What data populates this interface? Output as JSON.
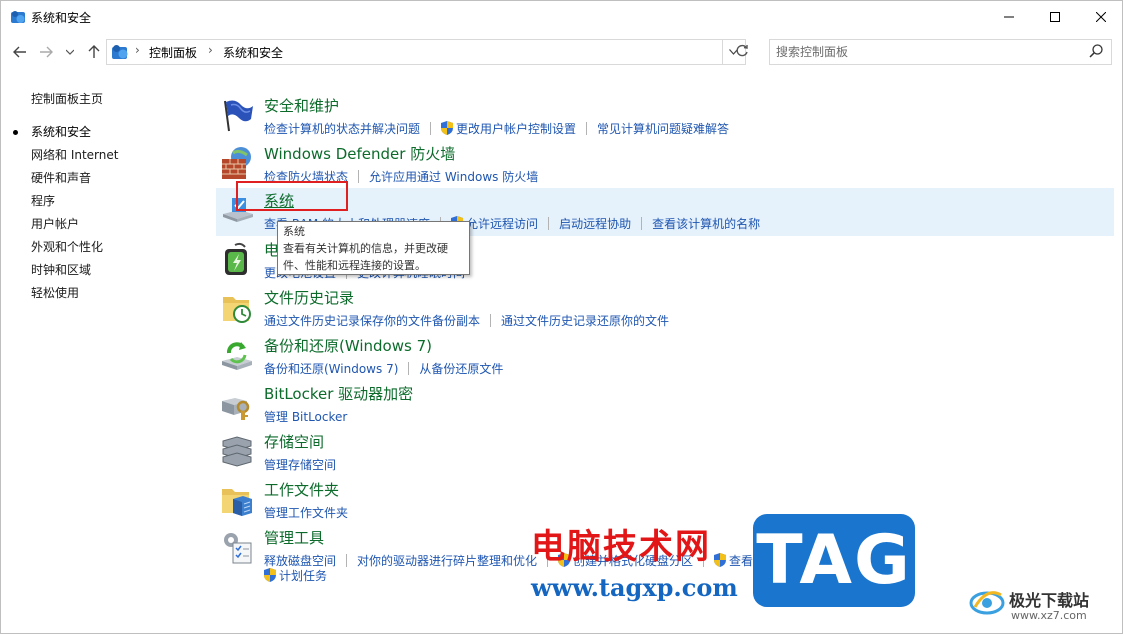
{
  "window": {
    "title": "系统和安全",
    "controls": {
      "minimize": "—",
      "maximize": "☐",
      "close": "✕"
    }
  },
  "navbar": {
    "breadcrumbs": [
      "控制面板",
      "系统和安全"
    ],
    "search_placeholder": "搜索控制面板"
  },
  "sidebar": {
    "items": [
      {
        "label": "控制面板主页"
      },
      {
        "label": "系统和安全",
        "current": true
      },
      {
        "label": "网络和 Internet"
      },
      {
        "label": "硬件和声音"
      },
      {
        "label": "程序"
      },
      {
        "label": "用户帐户"
      },
      {
        "label": "外观和个性化"
      },
      {
        "label": "时钟和区域"
      },
      {
        "label": "轻松使用"
      }
    ]
  },
  "categories": [
    {
      "title": "安全和维护",
      "icon": "flag-icon",
      "links": [
        "检查计算机的状态并解决问题",
        "更改用户帐户控制设置",
        "常见计算机问题疑难解答"
      ]
    },
    {
      "title": "Windows Defender 防火墙",
      "icon": "firewall-icon",
      "links": [
        "检查防火墙状态",
        "允许应用通过 Windows 防火墙"
      ]
    },
    {
      "title": "系统",
      "icon": "system-icon",
      "links": [
        "查看 RAM 的大小和处理器速度",
        "允许远程访问",
        "启动远程协助",
        "查看该计算机的名称"
      ]
    },
    {
      "title": "电源选项",
      "icon": "power-icon",
      "links": [
        "更改电池设置",
        "更改计算机睡眠时间"
      ]
    },
    {
      "title": "文件历史记录",
      "icon": "file-history-icon",
      "links": [
        "通过文件历史记录保存你的文件备份副本",
        "通过文件历史记录还原你的文件"
      ]
    },
    {
      "title": "备份和还原(Windows 7)",
      "icon": "backup-icon",
      "links": [
        "备份和还原(Windows 7)",
        "从备份还原文件"
      ]
    },
    {
      "title": "BitLocker 驱动器加密",
      "icon": "bitlocker-icon",
      "links": [
        "管理 BitLocker"
      ]
    },
    {
      "title": "存储空间",
      "icon": "storage-icon",
      "links": [
        "管理存储空间"
      ]
    },
    {
      "title": "工作文件夹",
      "icon": "work-folders-icon",
      "links": [
        "管理工作文件夹"
      ]
    },
    {
      "title": "管理工具",
      "icon": "admin-tools-icon",
      "links": [
        "释放磁盘空间",
        "对你的驱动器进行碎片整理和优化",
        "创建并格式化硬盘分区",
        "查看事件日志",
        "计划任务"
      ]
    }
  ],
  "tooltip": {
    "title": "系统",
    "body_line1": "查看有关计算机的信息，并更改硬",
    "body_line2": "件、性能和远程连接的设置。"
  },
  "watermark": {
    "site_name": "电脑技术网",
    "site_url": "www.tagxp.com",
    "tag": "TAG",
    "logo_name": "极光下载站",
    "logo_url": "www.xz7.com"
  },
  "colors": {
    "category_title": "#0c6b2b",
    "link": "#1f56b0",
    "highlight_row": "#e5f1fb",
    "red_box": "#e02020"
  }
}
